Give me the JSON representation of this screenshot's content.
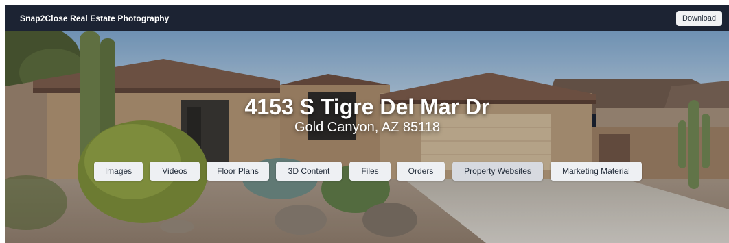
{
  "header": {
    "brand": "Snap2Close Real Estate Photography",
    "download_label": "Download"
  },
  "hero": {
    "address": "4153 S Tigre Del Mar Dr",
    "city_line": "Gold Canyon, AZ 85118"
  },
  "nav": {
    "items": [
      {
        "label": "Images"
      },
      {
        "label": "Videos"
      },
      {
        "label": "Floor Plans"
      },
      {
        "label": "3D Content"
      },
      {
        "label": "Files"
      },
      {
        "label": "Orders"
      },
      {
        "label": "Property Websites"
      },
      {
        "label": "Marketing Material"
      }
    ],
    "active_label": "Property Websites"
  },
  "colors": {
    "topbar": "#1c2333",
    "button_bg": "#eef0f3",
    "button_active_bg": "#d7dae0",
    "button_text": "#1f2937"
  }
}
